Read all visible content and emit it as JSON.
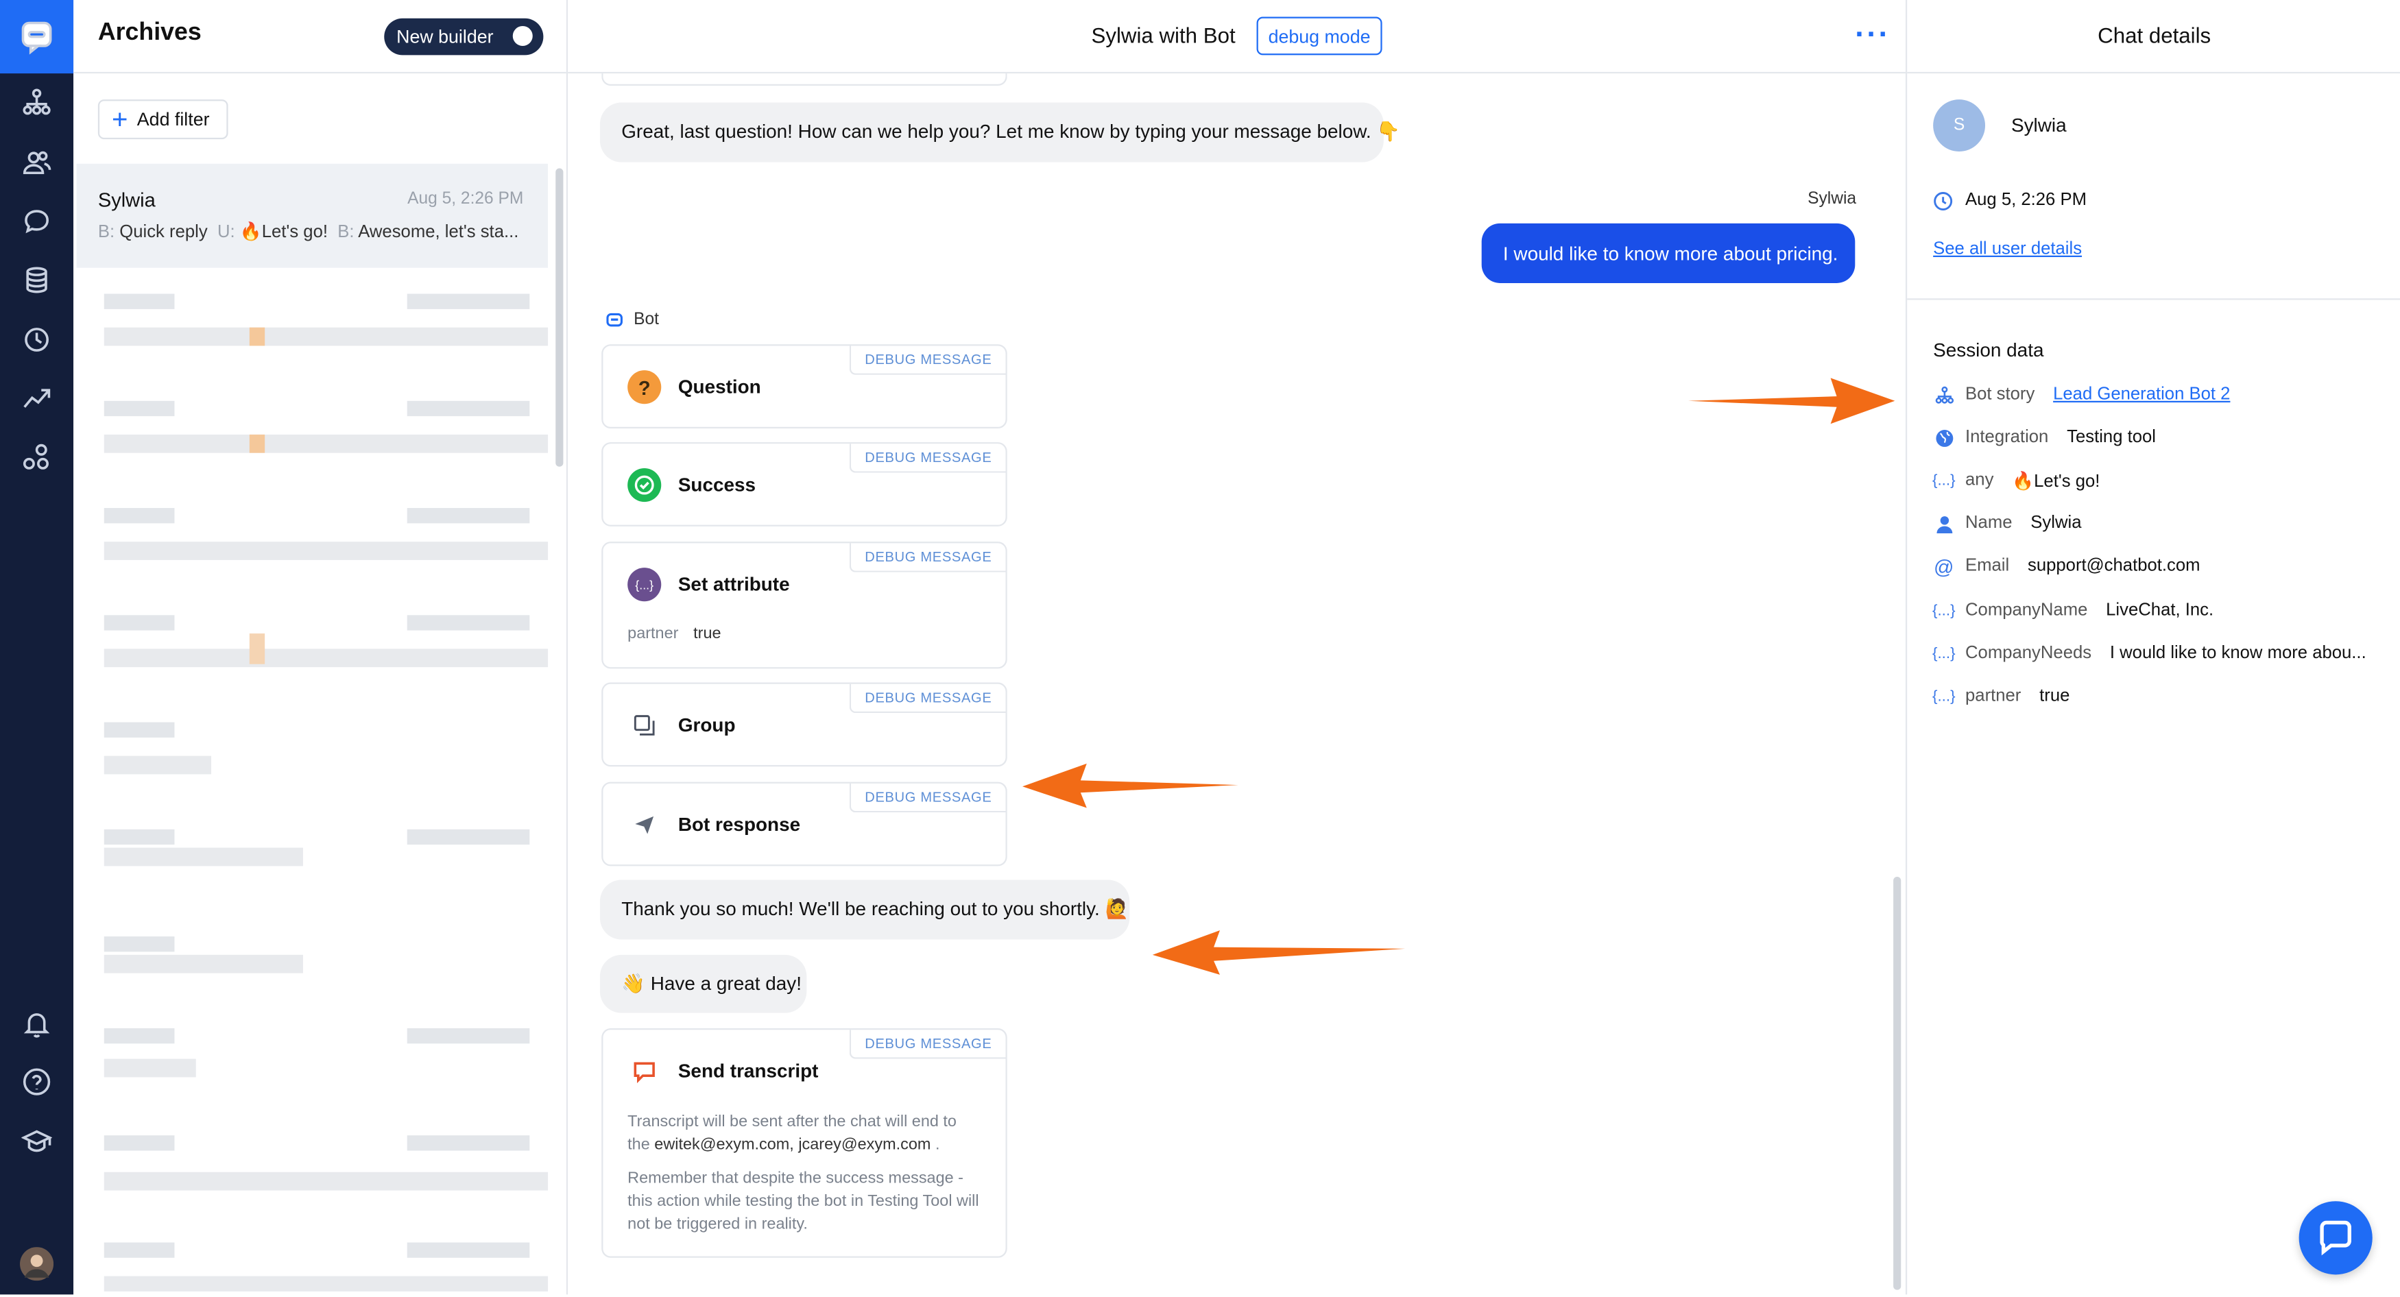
{
  "archives": {
    "title": "Archives",
    "toggle_label": "New builder",
    "add_filter": "Add filter",
    "selected": {
      "name": "Sylwia",
      "time": "Aug 5, 2:26 PM",
      "preview_b1_key": "B:",
      "preview_b1_val": "Quick reply",
      "preview_u_key": "U:",
      "preview_u_val": "🔥Let's go!",
      "preview_b2_key": "B:",
      "preview_b2_val": "Awesome, let's sta..."
    }
  },
  "chat": {
    "title": "Sylwia with Bot",
    "debug_button": "debug mode",
    "msg_last_question": "Great, last question! How can we help you? Let me know by typing your message below. 👇",
    "user_author": "Sylwia",
    "user_message": "I would like to know more about pricing.",
    "bot_author": "Bot",
    "debug_label": "DEBUG MESSAGE",
    "cards": {
      "question": "Question",
      "success": "Success",
      "set_attribute": "Set attribute",
      "attr_key": "partner",
      "attr_val": "true",
      "group": "Group",
      "bot_response": "Bot response",
      "send_transcript": "Send transcript",
      "transcript_line1": "Transcript will be sent after the chat will end to",
      "transcript_line2_pre": "the",
      "transcript_emails": "ewitek@exym.com, jcarey@exym.com",
      "transcript_line2_post": ".",
      "transcript_note": "Remember that despite the success message - this action while testing the bot in Testing Tool will not be triggered in reality."
    },
    "msg_thanks": "Thank you so much! We'll be reaching out to you shortly. 🙋",
    "msg_great_day": "👋 Have a great day!"
  },
  "details": {
    "title": "Chat details",
    "avatar_initial": "S",
    "name": "Sylwia",
    "time": "Aug 5, 2:26 PM",
    "see_all": "See all user details",
    "session_title": "Session data",
    "rows": [
      {
        "key": "Bot story",
        "value": "Lead Generation Bot 2"
      },
      {
        "key": "Integration",
        "value": "Testing tool"
      },
      {
        "key": "any",
        "value": "🔥Let's go!"
      },
      {
        "key": "Name",
        "value": "Sylwia"
      },
      {
        "key": "Email",
        "value": "support@chatbot.com"
      },
      {
        "key": "CompanyName",
        "value": "LiveChat, Inc."
      },
      {
        "key": "CompanyNeeds",
        "value": "I would like to know more abou..."
      },
      {
        "key": "partner",
        "value": "true"
      }
    ]
  },
  "colors": {
    "accent": "#1f6cf5",
    "rail": "#131e3a",
    "user_bubble": "#1a4fe8",
    "arrow": "#f26b16"
  }
}
